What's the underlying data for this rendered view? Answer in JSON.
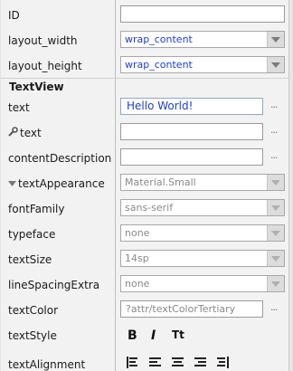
{
  "attributes": {
    "id": {
      "label": "ID",
      "value": ""
    },
    "layout_width": {
      "label": "layout_width",
      "value": "wrap_content"
    },
    "layout_height": {
      "label": "layout_height",
      "value": "wrap_content"
    }
  },
  "textview": {
    "section_title": "TextView",
    "text": {
      "label": "text",
      "value": "Hello World!"
    },
    "tools_text": {
      "label": "text",
      "value": ""
    },
    "contentDescription": {
      "label": "contentDescription",
      "value": ""
    },
    "textAppearance": {
      "label": "textAppearance",
      "value": "Material.Small"
    },
    "fontFamily": {
      "label": "fontFamily",
      "value": "sans-serif"
    },
    "typeface": {
      "label": "typeface",
      "value": "none"
    },
    "textSize": {
      "label": "textSize",
      "value": "14sp"
    },
    "lineSpacingExtra": {
      "label": "lineSpacingExtra",
      "value": "none"
    },
    "textColor": {
      "label": "textColor",
      "value": "?attr/textColorTertiary"
    },
    "textStyle": {
      "label": "textStyle"
    },
    "textAlignment": {
      "label": "textAlignment"
    }
  },
  "more_label": "...",
  "icons": {
    "wrench": "wrench-icon",
    "expand": "expand-triangle-icon",
    "bold": "B",
    "italic": "I",
    "allcaps": "Tt"
  },
  "colors": {
    "value_blue": "#1c3fd6",
    "background": "#f2f2f2"
  }
}
